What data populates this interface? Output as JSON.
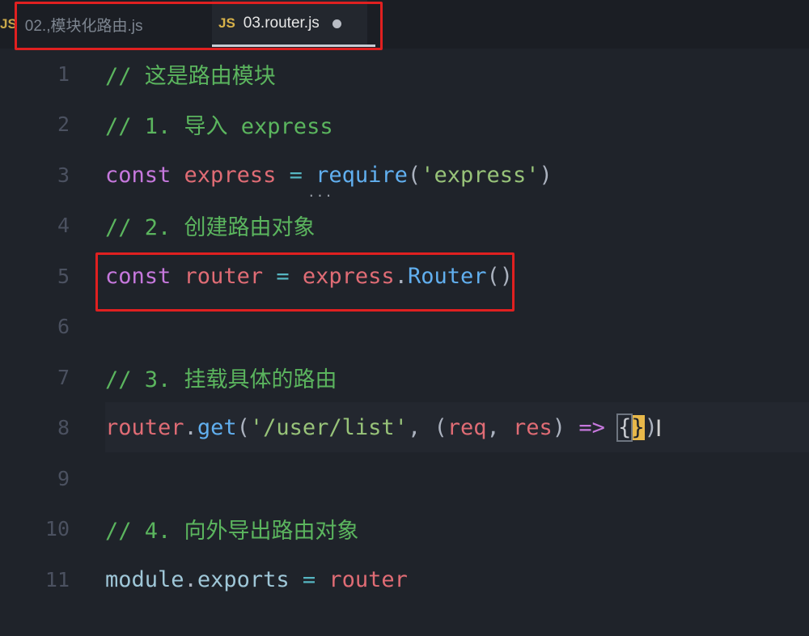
{
  "tabs": [
    {
      "badge": "JS",
      "label": "02.,模块化路由.js",
      "active": false
    },
    {
      "badge": "JS",
      "label": "03.router.js",
      "active": true,
      "modified": true
    }
  ],
  "lines": [
    {
      "num": "1",
      "tokens": [
        {
          "c": "cmt",
          "t": "// 这是路由模块"
        }
      ]
    },
    {
      "num": "2",
      "tokens": [
        {
          "c": "cmt",
          "t": "// 1. 导入 express"
        }
      ]
    },
    {
      "num": "3",
      "tokens": [
        {
          "c": "kw",
          "t": "const "
        },
        {
          "c": "var",
          "t": "express"
        },
        {
          "c": "op",
          "t": " = "
        },
        {
          "c": "fn",
          "t": "require"
        },
        {
          "c": "punc",
          "t": "("
        },
        {
          "c": "str",
          "t": "'express'"
        },
        {
          "c": "punc",
          "t": ")"
        }
      ]
    },
    {
      "num": "4",
      "tokens": [
        {
          "c": "cmt",
          "t": "// 2. 创建路由对象"
        }
      ]
    },
    {
      "num": "5",
      "tokens": [
        {
          "c": "kw",
          "t": "const "
        },
        {
          "c": "var",
          "t": "router"
        },
        {
          "c": "op",
          "t": " = "
        },
        {
          "c": "var",
          "t": "express"
        },
        {
          "c": "punc",
          "t": "."
        },
        {
          "c": "fn",
          "t": "Router"
        },
        {
          "c": "punc",
          "t": "()"
        }
      ]
    },
    {
      "num": "6",
      "tokens": []
    },
    {
      "num": "7",
      "tokens": [
        {
          "c": "cmt",
          "t": "// 3. 挂载具体的路由"
        }
      ]
    },
    {
      "num": "8",
      "current": true,
      "tokens": [
        {
          "c": "var",
          "t": "router"
        },
        {
          "c": "punc",
          "t": "."
        },
        {
          "c": "fn",
          "t": "get"
        },
        {
          "c": "punc",
          "t": "("
        },
        {
          "c": "str",
          "t": "'/user/list'"
        },
        {
          "c": "punc",
          "t": ", ("
        },
        {
          "c": "var",
          "t": "req"
        },
        {
          "c": "punc",
          "t": ", "
        },
        {
          "c": "var",
          "t": "res"
        },
        {
          "c": "punc",
          "t": ") "
        },
        {
          "c": "kw",
          "t": "=>"
        },
        {
          "c": "punc",
          "t": " "
        },
        {
          "c": "bracket-open",
          "t": "{"
        },
        {
          "c": "bracket-hl",
          "t": "}"
        },
        {
          "c": "punc",
          "t": ")"
        }
      ]
    },
    {
      "num": "9",
      "tokens": []
    },
    {
      "num": "10",
      "tokens": [
        {
          "c": "cmt",
          "t": "// 4. 向外导出路由对象"
        }
      ]
    },
    {
      "num": "11",
      "tokens": [
        {
          "c": "plainc",
          "t": "module"
        },
        {
          "c": "punc",
          "t": "."
        },
        {
          "c": "plainc",
          "t": "exports"
        },
        {
          "c": "op",
          "t": " = "
        },
        {
          "c": "var",
          "t": "router"
        }
      ]
    }
  ],
  "hover_indicator": "...",
  "cursor_glyph": "I"
}
